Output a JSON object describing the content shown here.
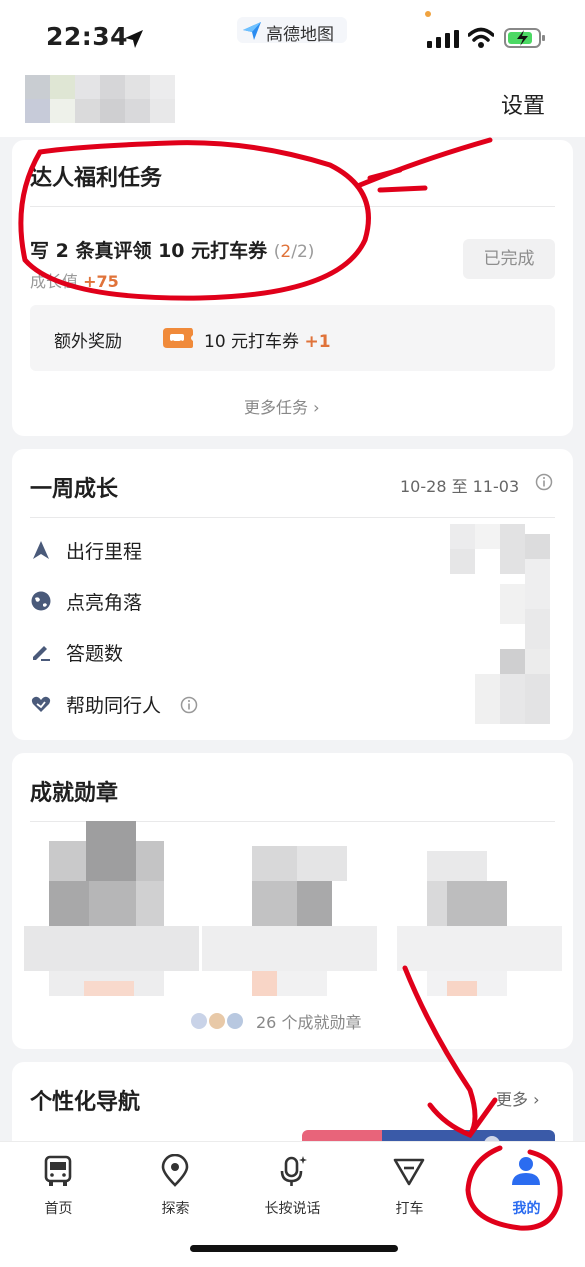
{
  "status_bar": {
    "time": "22:34",
    "app_name": "高德地图",
    "icons": [
      "location-arrow-icon",
      "signal-icon",
      "wifi-icon",
      "battery-charging-icon"
    ]
  },
  "header": {
    "settings_label": "设置"
  },
  "tasks_card": {
    "title": "达人福利任务",
    "task_text": "写 2 条真评领 10 元打车券",
    "progress_open": "(",
    "progress_current": "2",
    "progress_rest": "/2)",
    "growth_label": "成长值",
    "growth_value": "+75",
    "done_label": "已完成",
    "extra_label": "额外奖励",
    "ticket_label": "10 元打车券",
    "ticket_count": "+1",
    "more_label": "更多任务 ›"
  },
  "weekly_card": {
    "title": "一周成长",
    "date_range": "10-28 至 11-03",
    "metrics": [
      {
        "label": "出行里程",
        "icon": "navigation-arrow-icon"
      },
      {
        "label": "点亮角落",
        "icon": "globe-icon"
      },
      {
        "label": "答题数",
        "icon": "pencil-icon"
      },
      {
        "label": "帮助同行人",
        "icon": "heart-hand-icon"
      }
    ]
  },
  "badges_card": {
    "title": "成就勋章",
    "badges_count": "26 个成就勋章"
  },
  "nav_card": {
    "title": "个性化导航",
    "more_label": "更多 ›"
  },
  "tab_bar": {
    "tabs": [
      {
        "label": "首页",
        "icon": "bus-icon"
      },
      {
        "label": "探索",
        "icon": "map-pin-icon"
      },
      {
        "label": "长按说话",
        "icon": "microphone-icon"
      },
      {
        "label": "打车",
        "icon": "taxi-flag-icon"
      },
      {
        "label": "我的",
        "icon": "person-icon"
      }
    ],
    "active_tab": "我的"
  },
  "colors": {
    "accent_orange": "#e0733a",
    "active_blue": "#2b6cf0",
    "annotation_red": "#e0001a"
  }
}
